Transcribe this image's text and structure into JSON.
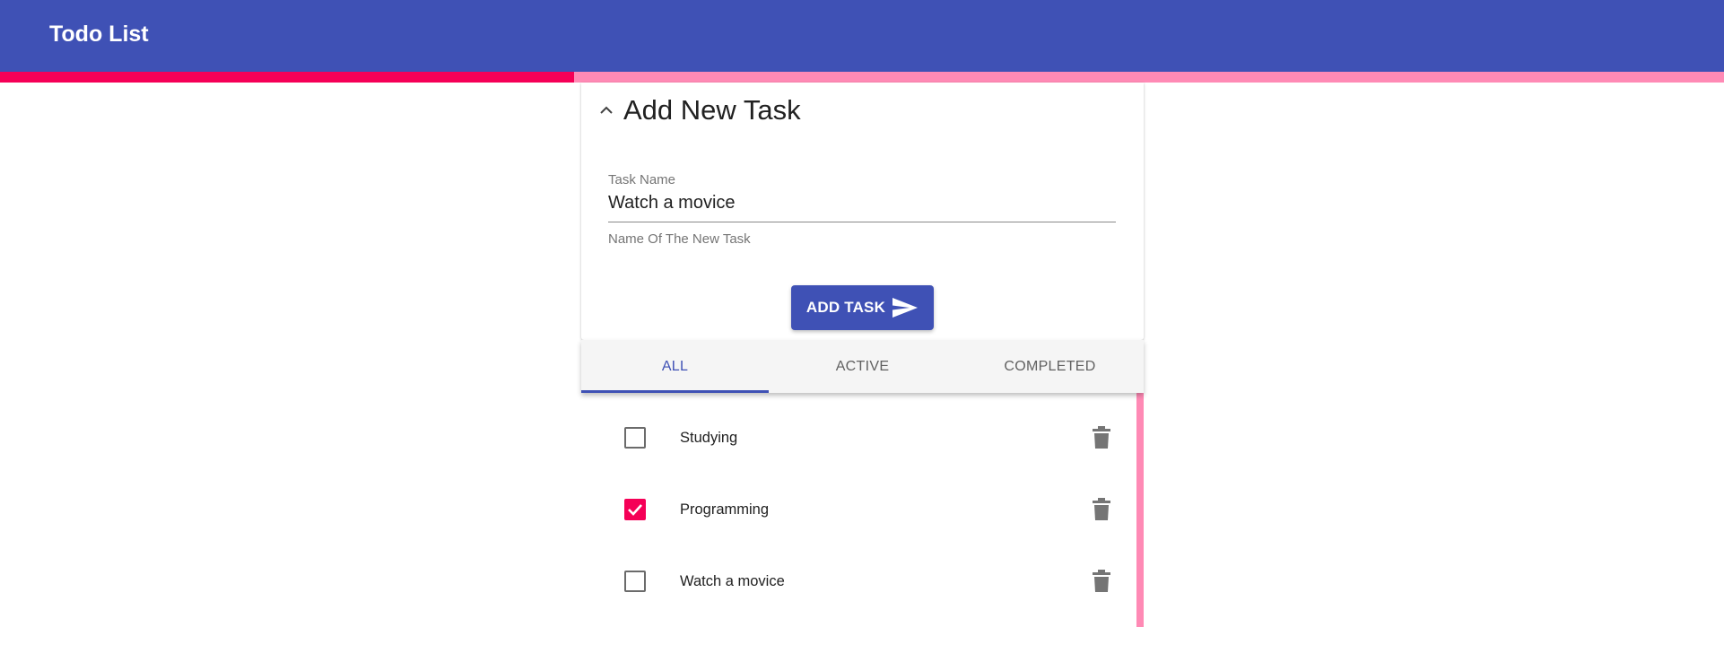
{
  "header": {
    "title": "Todo List"
  },
  "progress": {
    "completed_fraction": 0.333,
    "fill_color": "#f50057",
    "track_color": "#ff8ab5"
  },
  "add_panel": {
    "title": "Add New Task",
    "toggle_icon": "chevron-up-icon",
    "field_label": "Task Name",
    "field_value": "Watch a movice",
    "field_hint": "Name Of The New Task",
    "button_label": "ADD TASK",
    "button_icon": "send-icon"
  },
  "tabs": [
    {
      "label": "ALL",
      "active": true
    },
    {
      "label": "ACTIVE",
      "active": false
    },
    {
      "label": "COMPLETED",
      "active": false
    }
  ],
  "tasks": [
    {
      "label": "Studying",
      "completed": false
    },
    {
      "label": "Programming",
      "completed": true
    },
    {
      "label": "Watch a movice",
      "completed": false
    }
  ],
  "colors": {
    "primary": "#3f51b5",
    "accent": "#f50057",
    "accent_light": "#ff8ab5",
    "icon_gray": "#757575"
  }
}
